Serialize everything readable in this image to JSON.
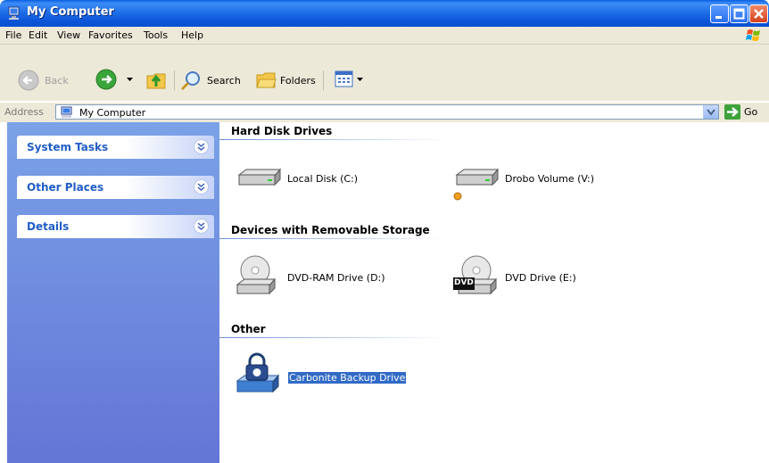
{
  "window": {
    "title": "My Computer"
  },
  "menu": [
    "File",
    "Edit",
    "View",
    "Favorites",
    "Tools",
    "Help"
  ],
  "toolbar": {
    "back": "Back",
    "search": "Search",
    "folders": "Folders"
  },
  "address": {
    "label": "Address",
    "value": "My Computer",
    "go": "Go"
  },
  "taskpane": {
    "sections": [
      {
        "label": "System Tasks"
      },
      {
        "label": "Other Places"
      },
      {
        "label": "Details"
      }
    ]
  },
  "content": {
    "groups": [
      {
        "title": "Hard Disk Drives",
        "items": [
          {
            "label": "Local Disk (C:)"
          },
          {
            "label": "Drobo Volume (V:)"
          }
        ]
      },
      {
        "title": "Devices with Removable Storage",
        "items": [
          {
            "label": "DVD-RAM Drive (D:)"
          },
          {
            "label": "DVD Drive (E:)",
            "badge": "DVD"
          }
        ]
      },
      {
        "title": "Other",
        "items": [
          {
            "label": "Carbonite Backup Drive",
            "selected": true
          }
        ]
      }
    ]
  },
  "colors": {
    "title_bar": "#0a54d8",
    "task_pane": "#7ba2e7",
    "selection": "#316ac5",
    "menubar": "#ece9d8"
  }
}
